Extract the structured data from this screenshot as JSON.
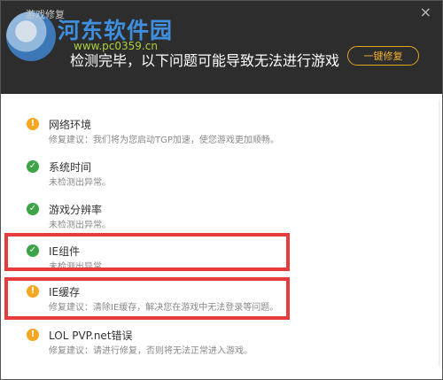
{
  "window": {
    "title": "游戏修复",
    "close_icon": "×"
  },
  "watermark": {
    "text": "河东软件园",
    "url": "www.pc0359.cn"
  },
  "header": {
    "headline": "检测完毕，以下问题可能导致无法进行游戏",
    "fix_button": "一键修复"
  },
  "colors": {
    "header_bg": "#2d2d2d",
    "accent": "#e3a520",
    "warning": "#f5a623",
    "success": "#3aa447",
    "highlight": "#e83b3b"
  },
  "items": [
    {
      "status": "warning",
      "icon": "warning-icon",
      "name": "网络环境",
      "desc": "修复建议：我们将为您启动TGP加速，使您游戏更加顺畅。"
    },
    {
      "status": "ok",
      "icon": "check-icon",
      "name": "系统时间",
      "desc": "未检测出异常。"
    },
    {
      "status": "ok",
      "icon": "check-icon",
      "name": "游戏分辨率",
      "desc": "未检测出异常。"
    },
    {
      "status": "ok",
      "icon": "check-icon",
      "name": "IE组件",
      "desc": "未检测出异常"
    },
    {
      "status": "warning",
      "icon": "warning-icon",
      "name": "IE缓存",
      "desc": "修复建议：清除IE缓存，解决您在游戏中无法登录等问题。"
    },
    {
      "status": "warning",
      "icon": "warning-icon",
      "name": "LOL PVP.net错误",
      "desc": "修复建议：请进行修复，否则将无法正常进入游戏。"
    }
  ]
}
